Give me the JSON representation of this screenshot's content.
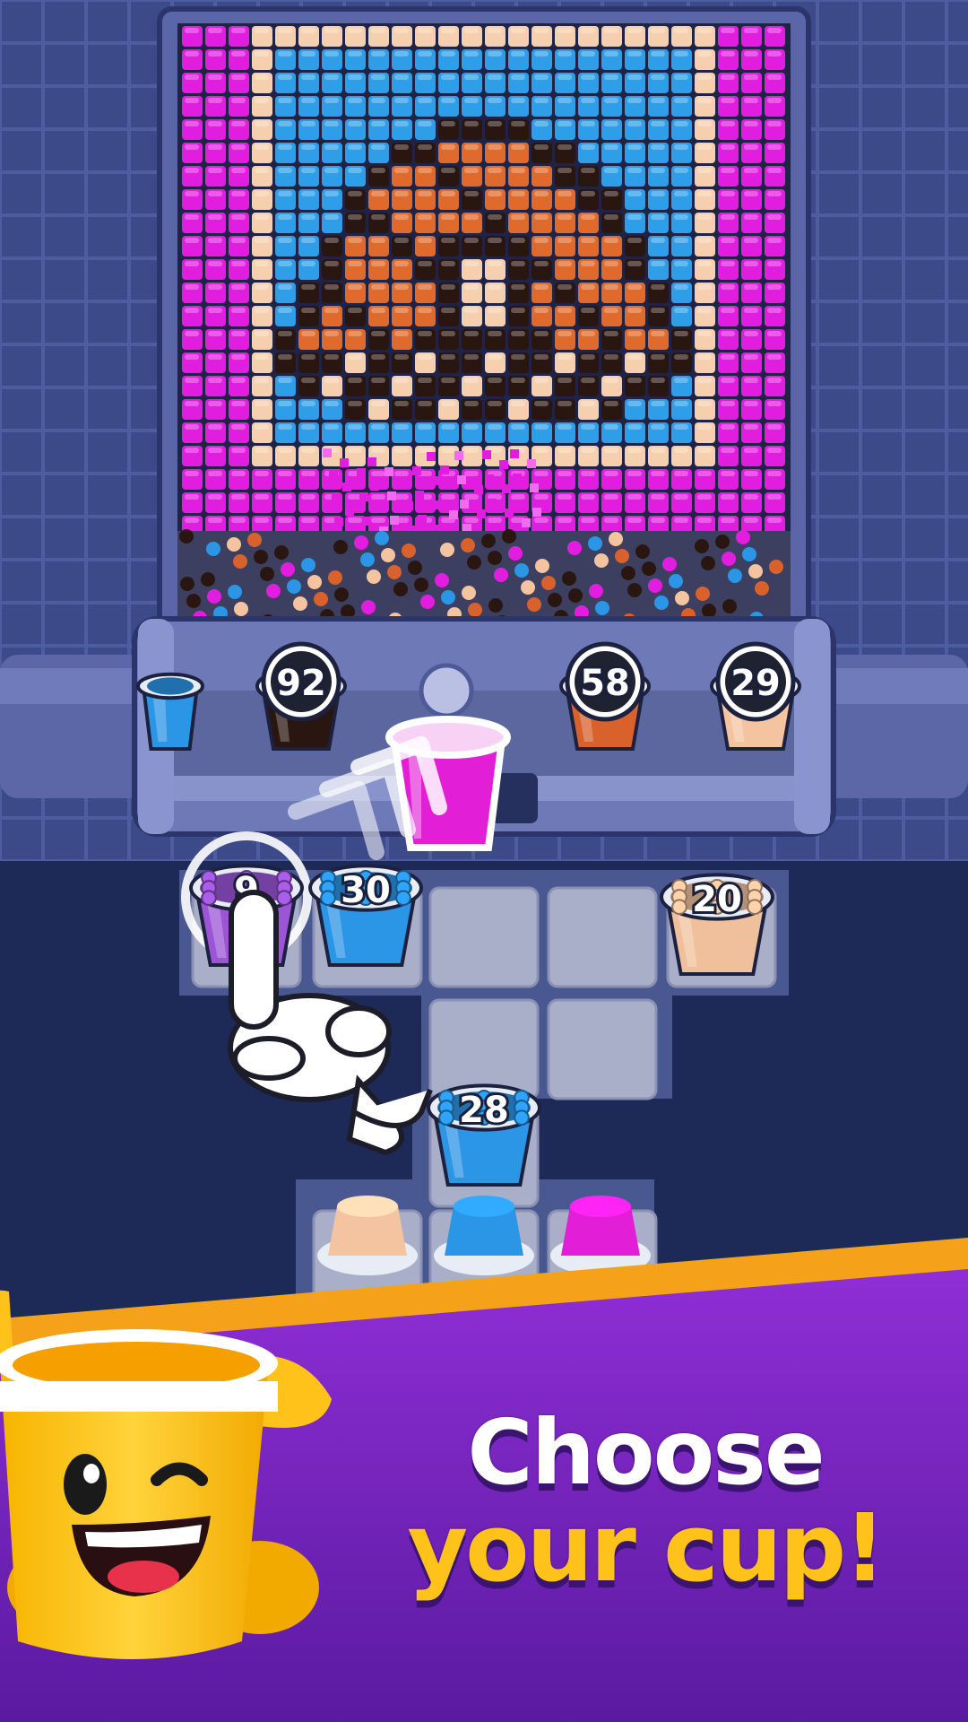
{
  "game": {
    "mosaic_palette": {
      "M": "#e11ee0",
      "P": "#f6cfae",
      "B": "#2f9ee8",
      "D": "#2a1610",
      "O": "#e06a2c"
    },
    "conveyor_cups": [
      {
        "count": "92",
        "color": "#2a1610"
      },
      {
        "count": "58",
        "color": "#d9612b"
      },
      {
        "count": "29",
        "color": "#f4c4a1"
      }
    ],
    "selected_cup": {
      "color": "#e21fd6"
    },
    "queue_cups": [
      {
        "count": "9",
        "color": "#9b55d6",
        "highlighted": true
      },
      {
        "count": "30",
        "color": "#2b95e6"
      },
      {
        "count": "20",
        "color": "#f0c09c"
      },
      {
        "count": "28",
        "color": "#2b95e6"
      }
    ],
    "bottom_cups": [
      "#f4c4a1",
      "#2b95e6",
      "#e21fd6"
    ]
  },
  "promo": {
    "line1": "Choose",
    "line2": "your cup!"
  },
  "colors": {
    "banner_purple": "#7a1fc4",
    "banner_stripe": "#f5a21a",
    "headline_yellow": "#ffc21a"
  }
}
